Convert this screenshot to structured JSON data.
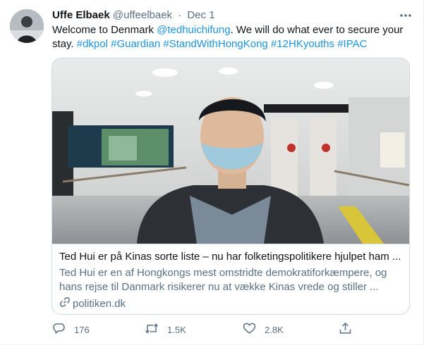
{
  "tweet": {
    "author_name": "Uffe Elbaek",
    "author_handle": "@uffeelbaek",
    "separator": "·",
    "date": "Dec 1",
    "text_parts": {
      "intro": "Welcome to Denmark ",
      "mention": "@tedhuichifung",
      "middle": ". We will do what ever to secure your stay. ",
      "hashtags": [
        "#dkpol",
        "#Guardian",
        "#StandWithHongKong",
        "#12HKyouths",
        "#IPAC"
      ]
    }
  },
  "card": {
    "title": "Ted Hui er på Kinas sorte liste – nu har folketingspolitikere hjulpet ham ...",
    "description": "Ted Hui er en af Hongkongs mest omstridte demokratiforkæmpere, og hans rejse til Danmark risikerer nu at vække Kinas vrede og stiller ...",
    "domain": "politiken.dk"
  },
  "actions": {
    "replies": "176",
    "retweets": "1.5K",
    "likes": "2.8K"
  },
  "colors": {
    "link": "#1b95e0",
    "secondary_text": "#5b7083",
    "border": "#cfd9de"
  },
  "icons": [
    "more-icon",
    "reply-icon",
    "retweet-icon",
    "like-icon",
    "share-icon",
    "link-icon"
  ]
}
